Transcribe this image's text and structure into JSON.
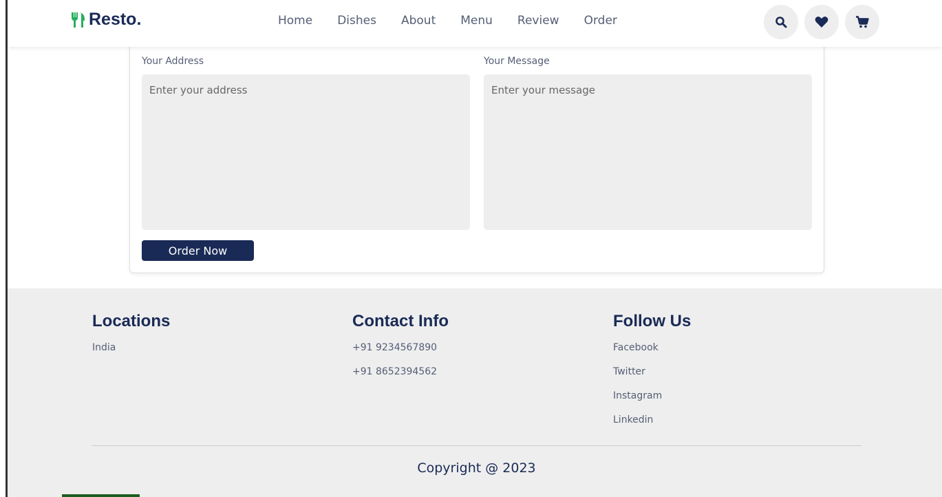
{
  "brand": {
    "name": "Resto.",
    "icon": "utensils-icon",
    "accent": "#27ae60"
  },
  "nav": {
    "items": [
      {
        "label": "Home"
      },
      {
        "label": "Dishes"
      },
      {
        "label": "About"
      },
      {
        "label": "Menu"
      },
      {
        "label": "Review"
      },
      {
        "label": "Order"
      }
    ]
  },
  "header_icons": [
    "search-icon",
    "heart-icon",
    "cart-icon"
  ],
  "form": {
    "address_label": "Your Address",
    "address_placeholder": "Enter your address",
    "message_label": "Your Message",
    "message_placeholder": "Enter your message",
    "submit_label": "Order Now"
  },
  "footer": {
    "locations": {
      "title": "Locations",
      "items": [
        "India"
      ]
    },
    "contact": {
      "title": "Contact Info",
      "items": [
        "+91 9234567890",
        "+91 8652394562"
      ]
    },
    "follow": {
      "title": "Follow Us",
      "items": [
        "Facebook",
        "Twitter",
        "Instagram",
        "Linkedin"
      ]
    },
    "copyright": "Copyright @ 2023"
  },
  "colors": {
    "primary": "#192a56",
    "footer_bg": "#eeeeee",
    "field_bg": "#eeeeee"
  }
}
